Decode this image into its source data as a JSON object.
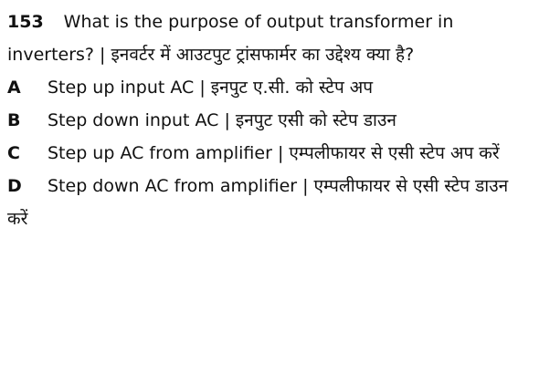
{
  "question": {
    "number": "153",
    "text": "What is the purpose of output transformer in inverters? | इनवर्टर में आउटपुट ट्रांसफार्मर का उद्देश्य क्या है?"
  },
  "options": [
    {
      "letter": "A",
      "text": "Step up input AC | इनपुट ए.सी. को स्टेप अप"
    },
    {
      "letter": "B",
      "text": "Step down input AC | इनपुट एसी को स्टेप डाउन"
    },
    {
      "letter": "C",
      "text": "Step up AC from amplifier | एम्पलीफायर से एसी स्टेप अप करें"
    },
    {
      "letter": "D",
      "text": "Step down AC from amplifier | एम्पलीफायर से एसी स्टेप डाउन करें"
    }
  ]
}
